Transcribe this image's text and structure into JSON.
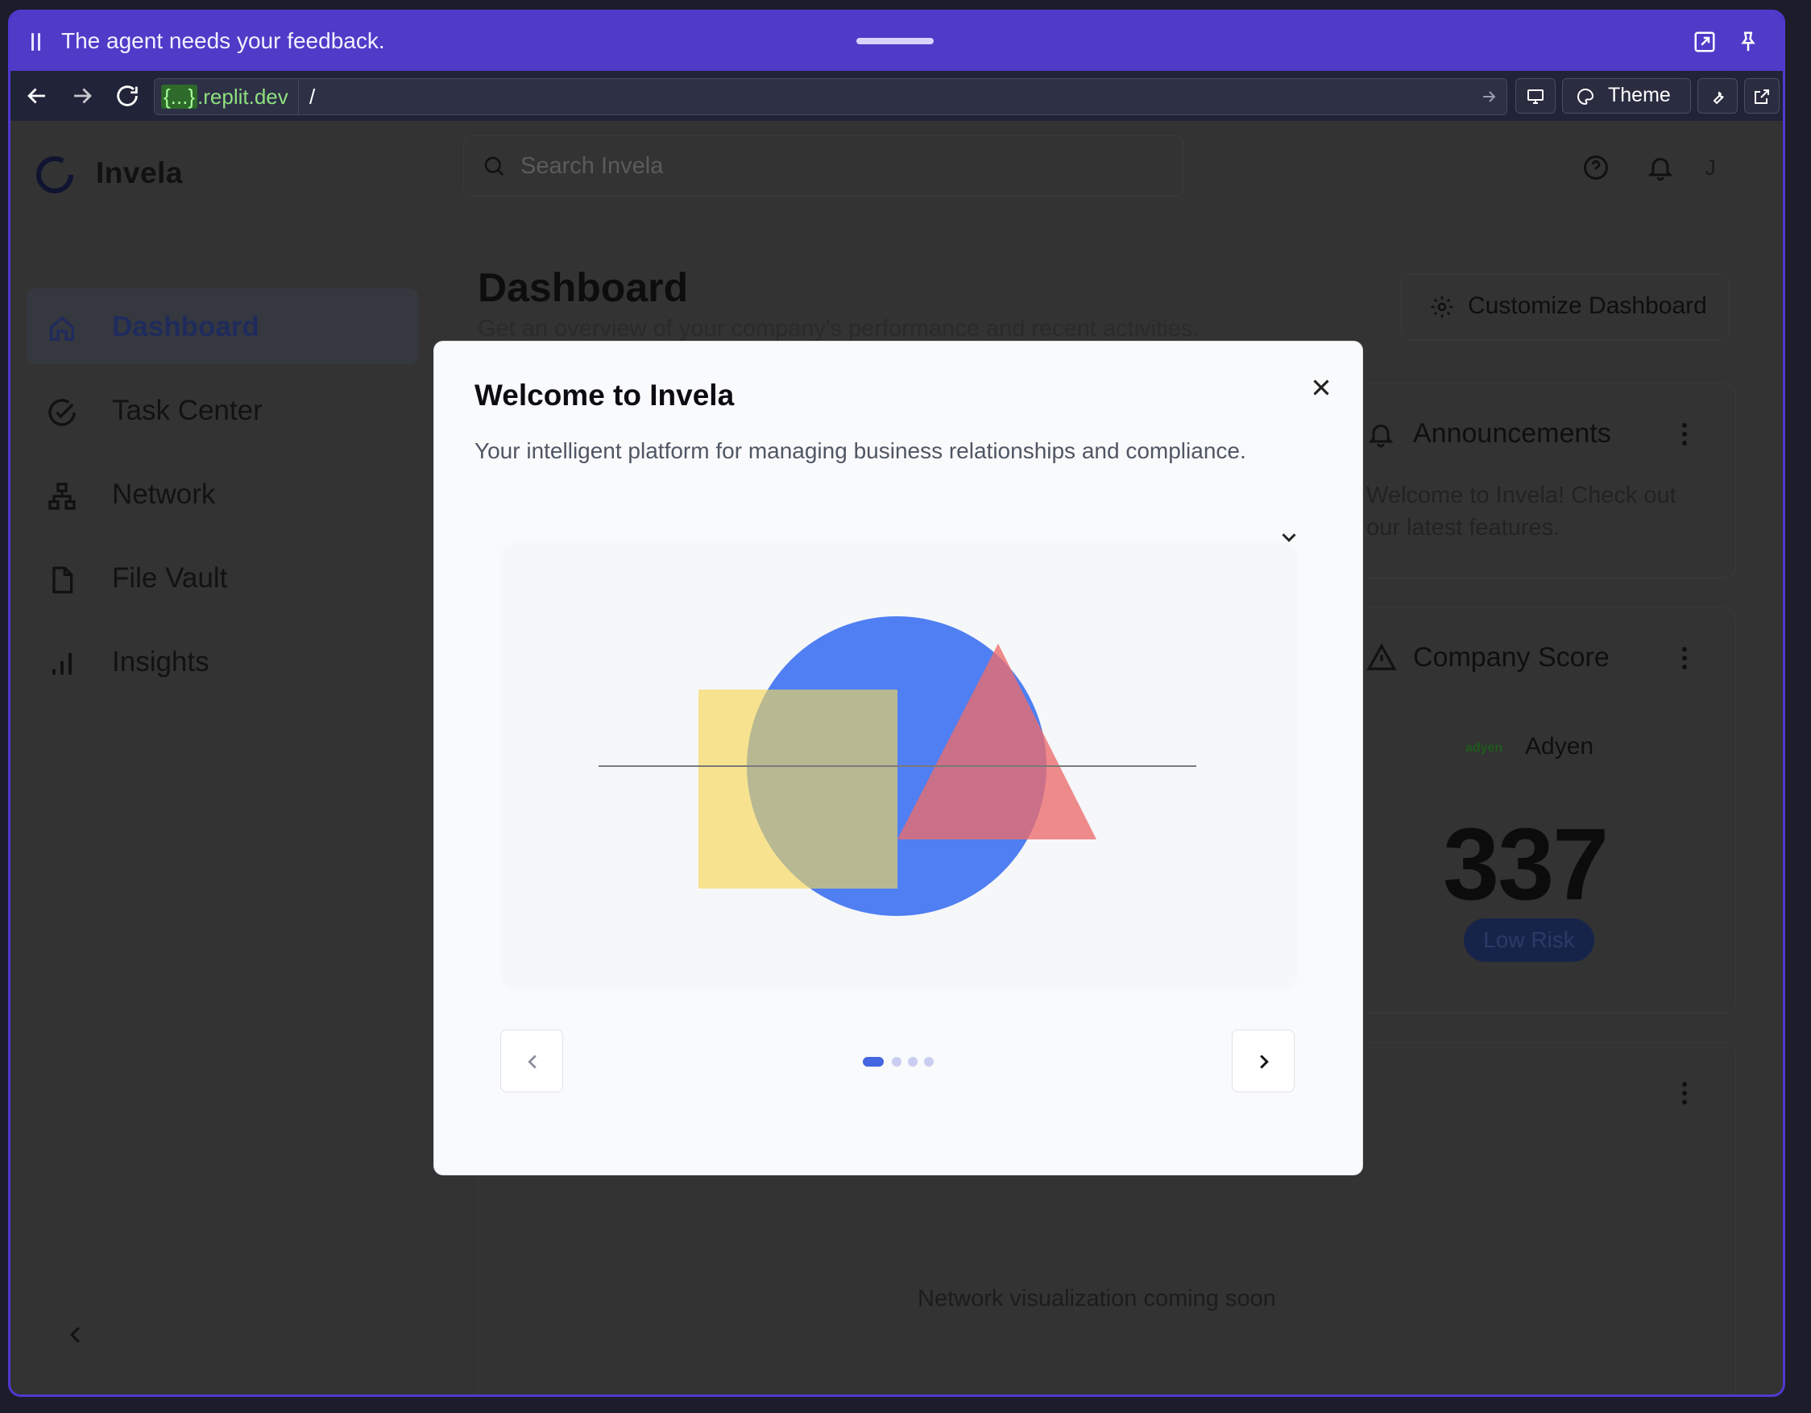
{
  "agent_bar": {
    "message": "The agent needs your feedback."
  },
  "browser": {
    "url_host_brace": "{...}",
    "url_host_rest": ".replit.dev",
    "url_path": "/",
    "theme_label": "Theme"
  },
  "app": {
    "brand": "Invela",
    "search_placeholder": "Search Invela",
    "user_initial": "J"
  },
  "sidebar": {
    "items": [
      {
        "label": "Dashboard",
        "icon": "home-icon",
        "active": true
      },
      {
        "label": "Task Center",
        "icon": "check-circle-icon"
      },
      {
        "label": "Network",
        "icon": "network-icon"
      },
      {
        "label": "File Vault",
        "icon": "file-icon"
      },
      {
        "label": "Insights",
        "icon": "bar-chart-icon"
      }
    ]
  },
  "dashboard": {
    "title": "Dashboard",
    "subtitle": "Get an overview of your company's performance and recent activities.",
    "customize_label": "Customize Dashboard",
    "announcements": {
      "title": "Announcements",
      "text_line1": "Welcome to Invela! Check out",
      "text_line2": "our latest features."
    },
    "company_score": {
      "title": "Company Score",
      "logo_text": "adyen",
      "company": "Adyen",
      "score": "337",
      "risk": "Low Risk"
    },
    "network": {
      "placeholder": "Network visualization coming soon"
    }
  },
  "modal": {
    "title": "Welcome to Invela",
    "subtitle": "Your intelligent platform for managing business relationships and compliance.",
    "current_slide": 1,
    "total_slides": 4
  },
  "colors": {
    "agent_bar": "#4e3bc8",
    "accent": "#4466e0",
    "circle": "#4f7ff2",
    "square": "#f7e38f",
    "triangle": "#ed6b6b"
  }
}
